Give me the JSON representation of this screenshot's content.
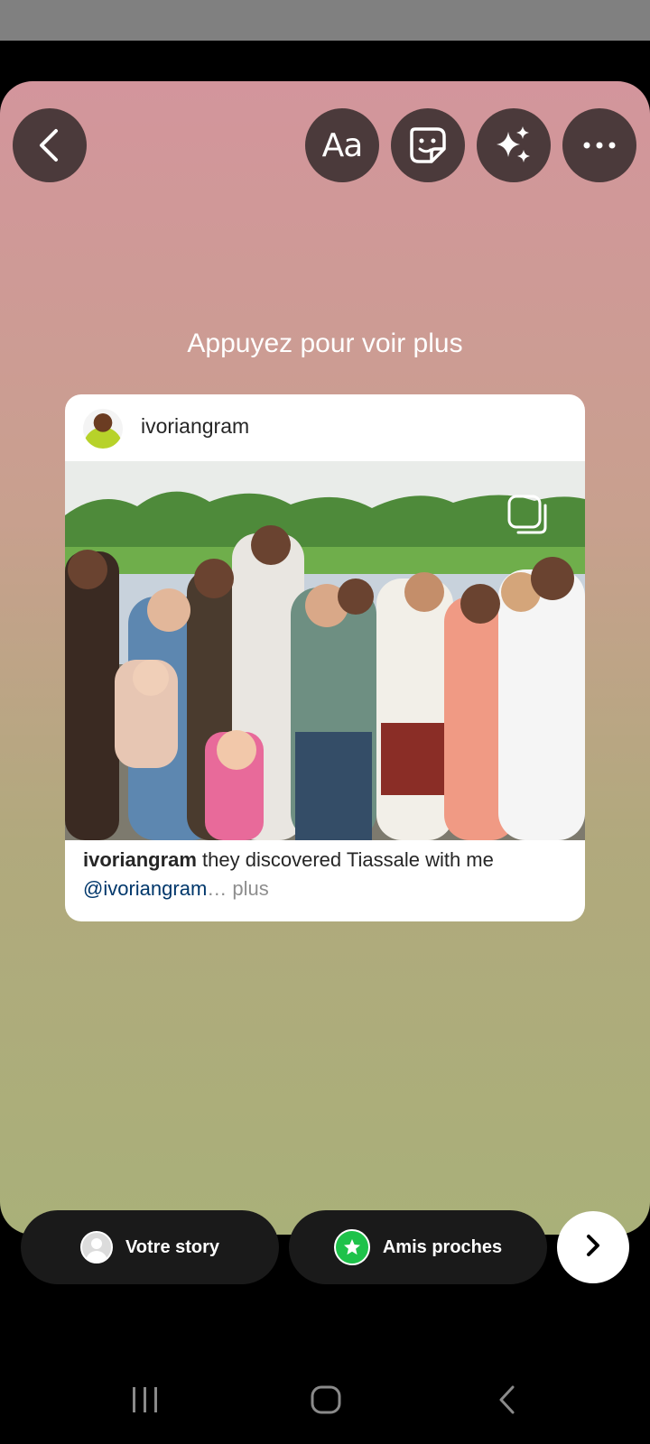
{
  "toolbar": {
    "text_label": "Aa",
    "icons": [
      "back-chevron-icon",
      "sticker-icon",
      "sparkles-effects-icon",
      "more-dots-icon"
    ]
  },
  "hint_text": "Appuyez pour voir plus",
  "post": {
    "username": "ivoriangram",
    "caption_user": "ivoriangram",
    "caption_text": " they discovered Tiassale with me",
    "mention": "@ivoriangram",
    "ellipsis": "…",
    "more_label": " plus",
    "image_icon": "carousel-icon"
  },
  "share": {
    "your_story_label": "Votre story",
    "close_friends_label": "Amis proches",
    "close_friends_color": "#1ec24a"
  },
  "colors": {
    "gradient_top": "#d3959c",
    "gradient_bottom": "#a9b079",
    "button_bg": "#4b3a3b",
    "pill_bg": "#1a1a1a",
    "mention": "#00376b"
  }
}
